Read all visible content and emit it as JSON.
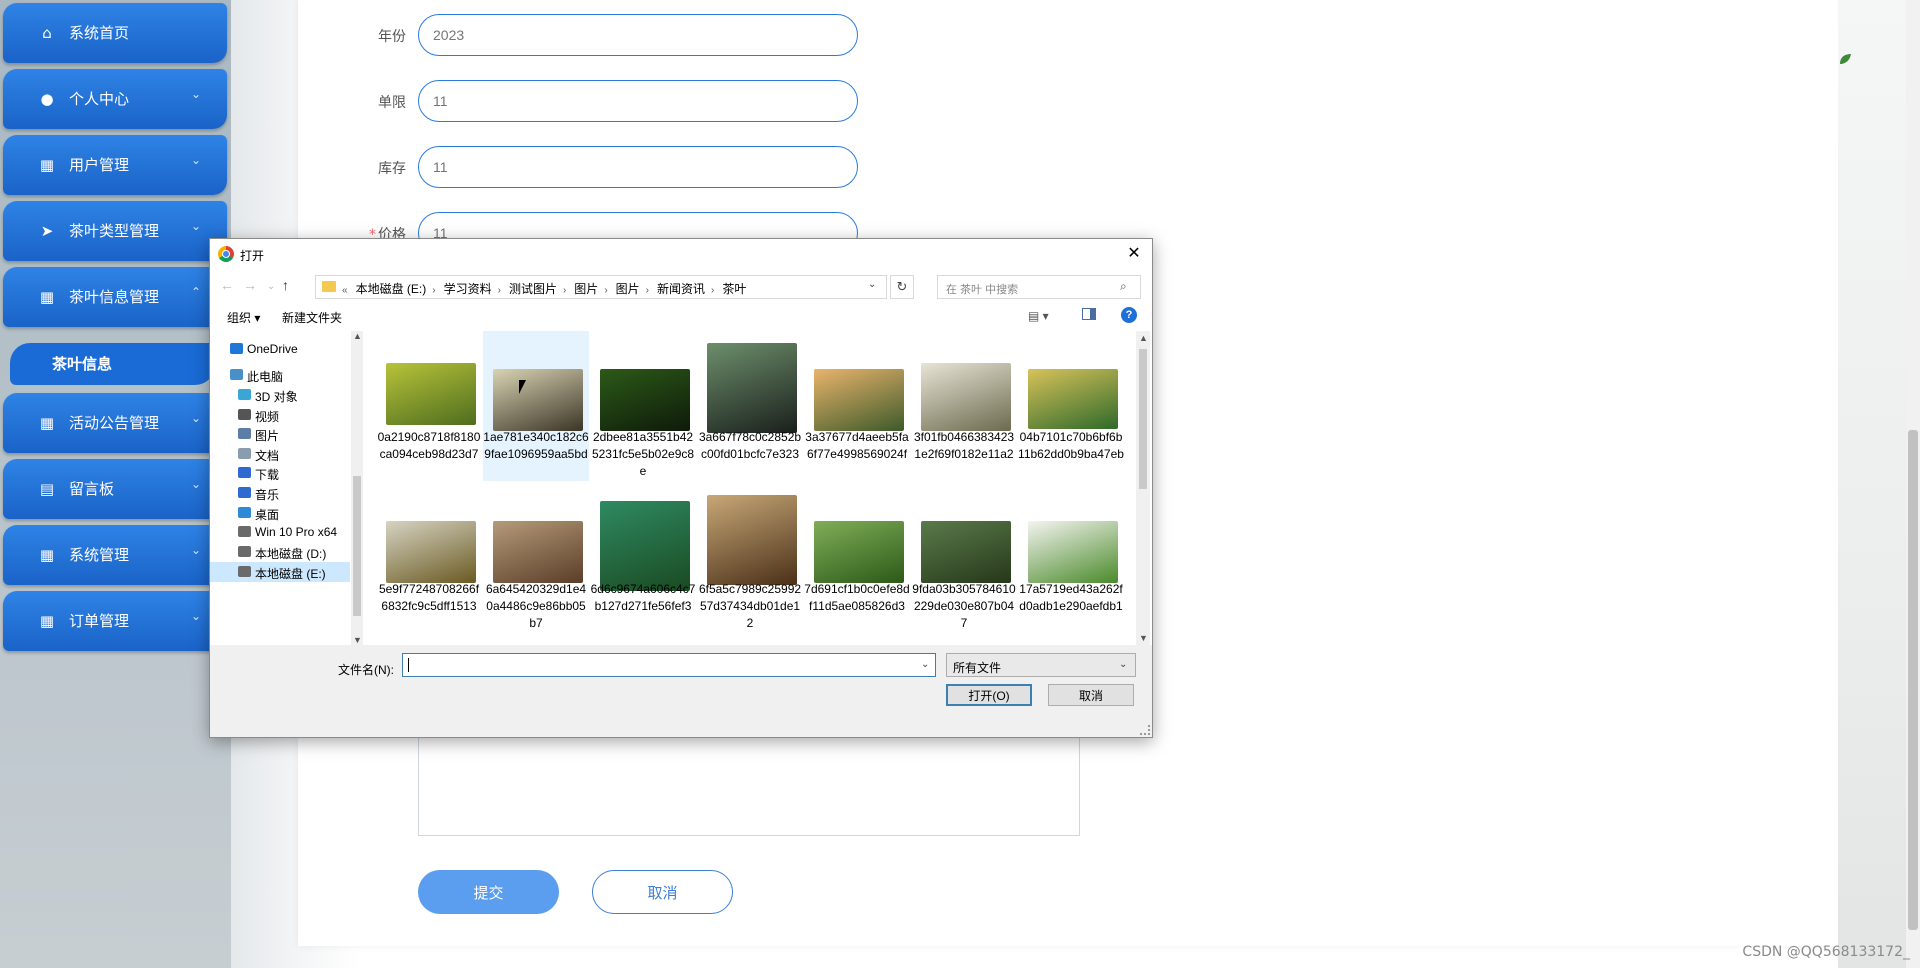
{
  "sidebar": {
    "items": [
      {
        "label": "系统首页",
        "icon": "home-icon",
        "arrow": ""
      },
      {
        "label": "个人中心",
        "icon": "user-icon",
        "arrow": "⌄"
      },
      {
        "label": "用户管理",
        "icon": "grid-icon",
        "arrow": "⌄"
      },
      {
        "label": "茶叶类型管理",
        "icon": "send-icon",
        "arrow": "⌄"
      },
      {
        "label": "茶叶信息管理",
        "icon": "grid-icon",
        "arrow": "⌃"
      },
      {
        "label": "活动公告管理",
        "icon": "grid-icon",
        "arrow": "⌄"
      },
      {
        "label": "留言板",
        "icon": "board-icon",
        "arrow": "⌄"
      },
      {
        "label": "系统管理",
        "icon": "grid-icon",
        "arrow": "⌄"
      },
      {
        "label": "订单管理",
        "icon": "grid-icon",
        "arrow": "⌄"
      }
    ],
    "submenu": {
      "label": "茶叶信息"
    }
  },
  "form": {
    "fields": [
      {
        "label": "年份",
        "value": "2023",
        "required": false
      },
      {
        "label": "单限",
        "value": "11",
        "required": false
      },
      {
        "label": "库存",
        "value": "11",
        "required": false
      },
      {
        "label": "价格",
        "value": "11",
        "required": true
      }
    ],
    "submit_label": "提交",
    "cancel_label": "取消"
  },
  "watermark": "CSDN @QQ568133172_",
  "dialog": {
    "title": "打开",
    "close_glyph": "✕",
    "breadcrumb_prefix": "«",
    "breadcrumb": [
      "本地磁盘 (E:)",
      "学习资料",
      "测试图片",
      "图片",
      "图片",
      "新闻资讯",
      "茶叶"
    ],
    "search_placeholder": "在 茶叶 中搜索",
    "toolbar": {
      "organize": "组织 ▾",
      "new_folder": "新建文件夹"
    },
    "tree": [
      {
        "label": "OneDrive",
        "icon": "cloud-icon",
        "color": "#1e78d7"
      },
      {
        "label": "此电脑",
        "icon": "computer-icon",
        "color": "#4a90c8"
      },
      {
        "label": "3D 对象",
        "icon": "cube-icon",
        "color": "#3aa6d6"
      },
      {
        "label": "视频",
        "icon": "video-icon",
        "color": "#555555"
      },
      {
        "label": "图片",
        "icon": "picture-icon",
        "color": "#5a7ea8"
      },
      {
        "label": "文档",
        "icon": "document-icon",
        "color": "#8a9cb0"
      },
      {
        "label": "下载",
        "icon": "download-icon",
        "color": "#2e6ad0"
      },
      {
        "label": "音乐",
        "icon": "music-icon",
        "color": "#2e6ad0"
      },
      {
        "label": "桌面",
        "icon": "desktop-icon",
        "color": "#2e8ad6"
      },
      {
        "label": "Win 10 Pro x64",
        "icon": "drive-icon",
        "color": "#6a6a6a"
      },
      {
        "label": "本地磁盘 (D:)",
        "icon": "drive-icon",
        "color": "#6a6a6a"
      },
      {
        "label": "本地磁盘 (E:)",
        "icon": "drive-icon",
        "color": "#6a6a6a"
      }
    ],
    "files": [
      {
        "name": "0a2190c8718f8180ca094ceb98d23d7",
        "colors": [
          "#b8c33a",
          "#4e6d1e"
        ]
      },
      {
        "name": "1ae781e340c182c69fae1096959aa5bd",
        "colors": [
          "#d9d3b4",
          "#3b3527"
        ]
      },
      {
        "name": "2dbee81a3551b425231fc5e5b02e9c8e",
        "colors": [
          "#2c5a18",
          "#0e1a0a"
        ]
      },
      {
        "name": "3a667f78c0c2852bc00fd01bcfc7e323",
        "colors": [
          "#6d8f6c",
          "#1a1f1c"
        ]
      },
      {
        "name": "3a37677d4aeeb5fa6f77e4998569024f",
        "colors": [
          "#e9b46c",
          "#3d5a2a"
        ]
      },
      {
        "name": "3f01fb04663834231e2f69f0182e11a2",
        "colors": [
          "#e8e4d6",
          "#6c6a4e"
        ]
      },
      {
        "name": "04b7101c70b6bf6b11b62dd0b9ba47eb",
        "colors": [
          "#d8c25a",
          "#2e6a2a"
        ]
      },
      {
        "name": "5e9f77248708266f6832fc9c5dff1513",
        "colors": [
          "#d6d3c2",
          "#6a5a22"
        ]
      },
      {
        "name": "6a645420329d1e40a4486c9e86bb05b7",
        "colors": [
          "#b59a7a",
          "#5a3e28"
        ]
      },
      {
        "name": "6d6c9674a606c4c7b127d271fe56fef3",
        "colors": [
          "#2f8a62",
          "#1a4a22"
        ]
      },
      {
        "name": "6f5a5c7989c2599257d37434db01de12",
        "colors": [
          "#c8a878",
          "#4a3018"
        ]
      },
      {
        "name": "7d691cf1b0c0efe8df11d5ae085826d3",
        "colors": [
          "#7fae58",
          "#2c5a18"
        ]
      },
      {
        "name": "9fda03b305784610229de030e807b047",
        "colors": [
          "#5a7a4a",
          "#26381a"
        ]
      },
      {
        "name": "17a5719ed43a262fd0adb1e290aefdb1",
        "colors": [
          "#f4f4f0",
          "#4a8a2a"
        ]
      }
    ],
    "filename_label": "文件名(N):",
    "filename_value": "",
    "filetype": "所有文件",
    "open_label": "打开(O)",
    "cancel_label": "取消"
  }
}
